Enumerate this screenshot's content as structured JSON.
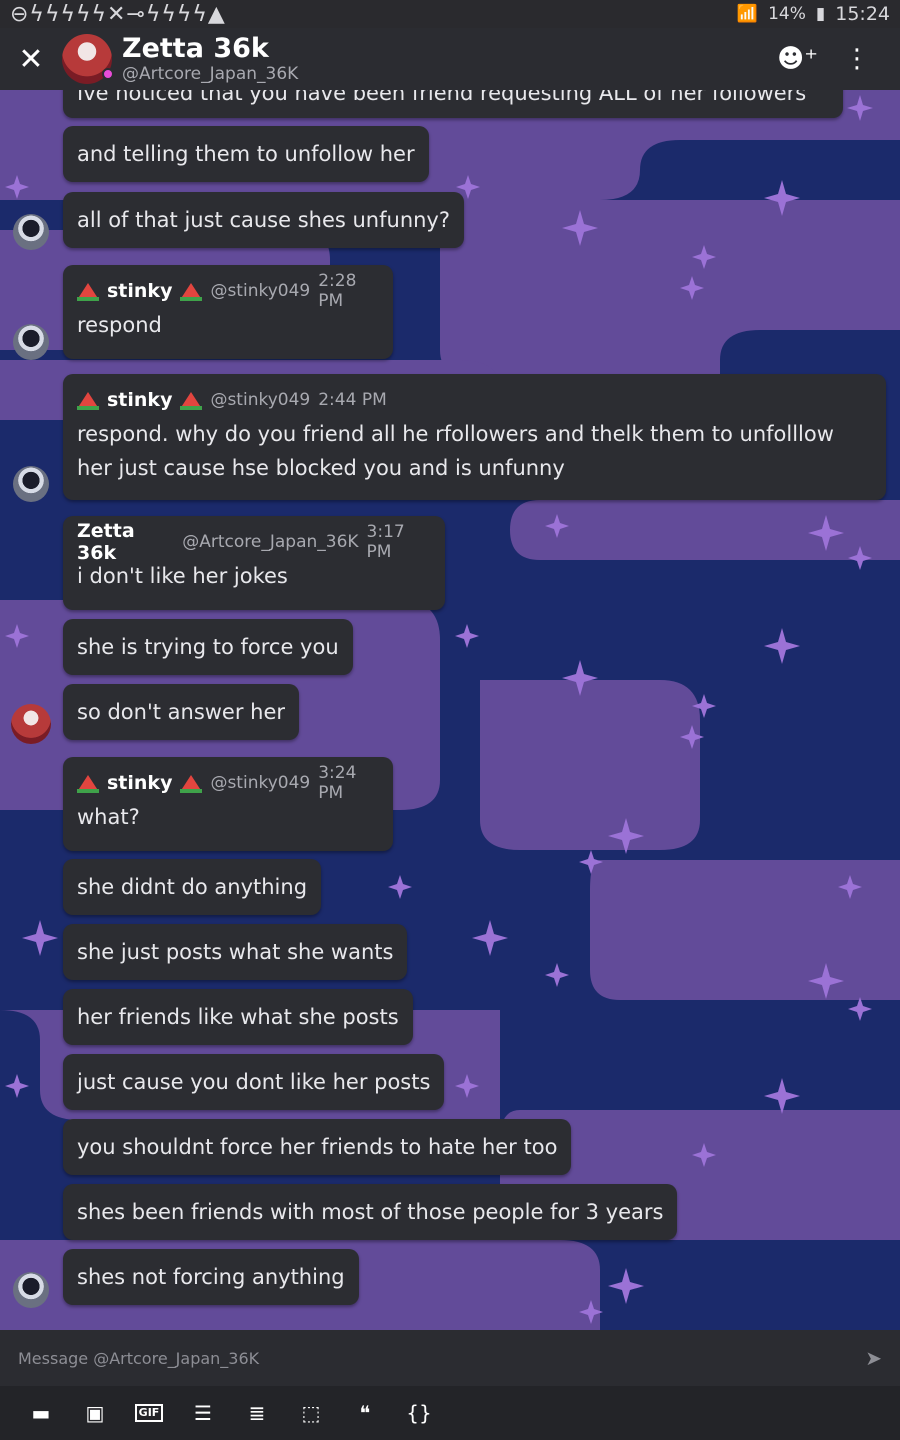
{
  "status_bar": {
    "left_icons": "⊖ϟϟϟϟϟ✕⊸ϟϟϟϟ▲",
    "battery": "14%",
    "time": "15:24"
  },
  "header": {
    "name": "Zetta 36k",
    "handle": "@Artcore_Japan_36K",
    "close_icon": "close-icon",
    "add_friend_icon": "add-friend-icon",
    "more_icon": "more-vertical-icon"
  },
  "messages": [
    {
      "text": "Ive noticed that you have been friend requesting ALL of her followers"
    },
    {
      "text": "and telling them to unfollow her"
    },
    {
      "text": "all of that just cause shes unfunny?"
    },
    {
      "author": "stinky",
      "handle": "@stinky049",
      "time": "2:28 PM",
      "text": "respond"
    },
    {
      "author": "stinky",
      "handle": "@stinky049",
      "time": "2:44 PM",
      "text": "respond. why do you friend all he rfollowers and thelk them to unfolllow her just cause hse blocked you and is unfunny"
    },
    {
      "author": "Zetta 36k",
      "handle": "@Artcore_Japan_36K",
      "time": "3:17 PM",
      "text": "i don't like her jokes"
    },
    {
      "text": "she is trying to force you"
    },
    {
      "text": "so don't answer her"
    },
    {
      "author": "stinky",
      "handle": "@stinky049",
      "time": "3:24 PM",
      "text": "what?"
    },
    {
      "text": "she didnt do anything"
    },
    {
      "text": "she just posts what she wants"
    },
    {
      "text": "her friends like what she posts"
    },
    {
      "text": "just cause you dont like her posts"
    },
    {
      "text": "you shouldnt force her friends to hate her too"
    },
    {
      "text": "shes been friends with most of those people for 3 years"
    },
    {
      "text": "shes not forcing anything"
    }
  ],
  "composer": {
    "placeholder": "Message @Artcore_Japan_36K",
    "send_icon": "send-icon"
  },
  "toolbar": {
    "gif_label": "GIF",
    "quote_label": "❝",
    "code_label": "{}"
  },
  "colors": {
    "background": "#1b2a6b",
    "cloud": "#6a4f9e",
    "bubble": "#2c2d32",
    "header": "#2b2c31",
    "presence": "#e94cd8"
  }
}
